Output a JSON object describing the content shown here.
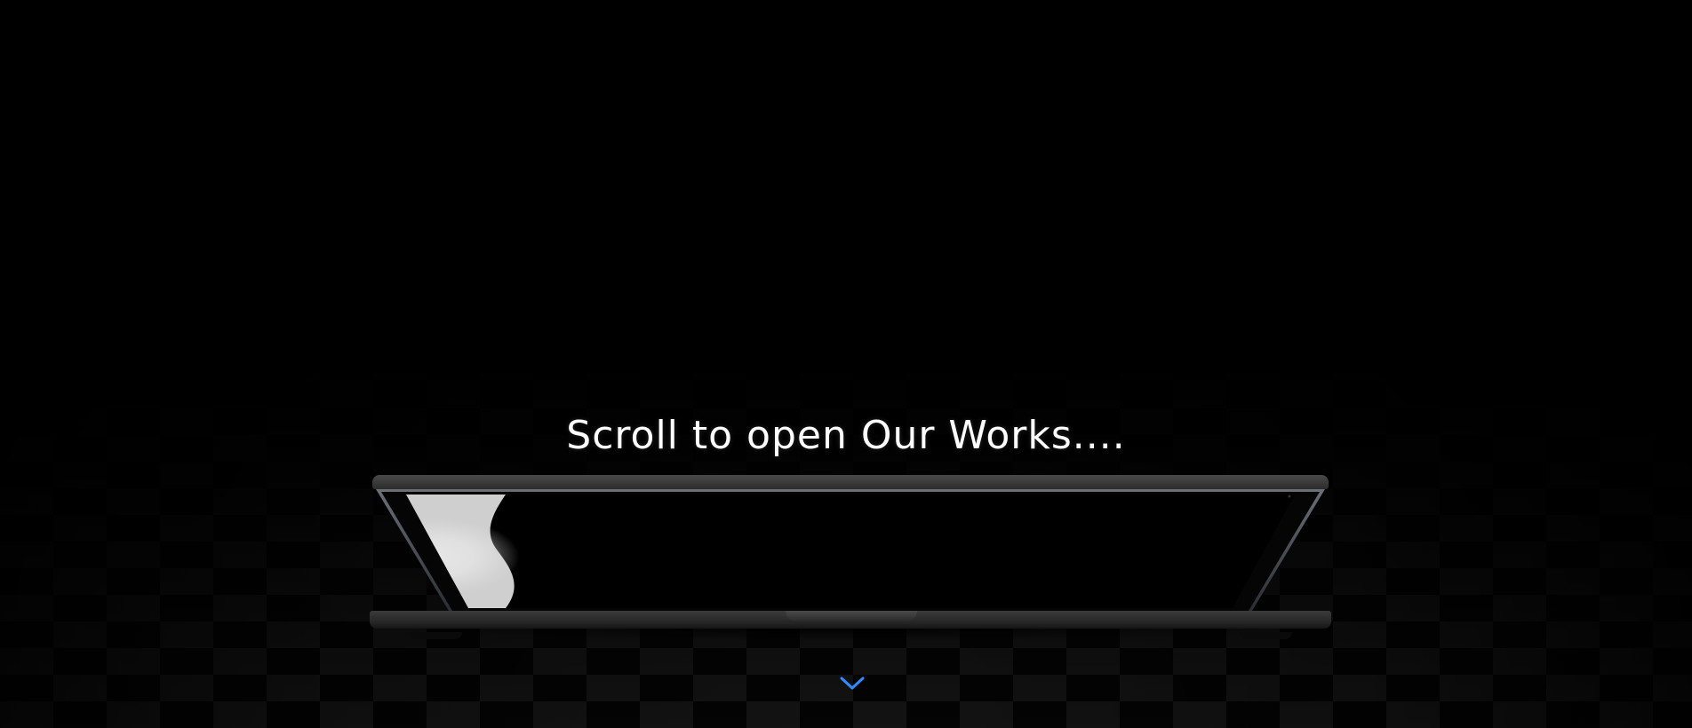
{
  "hero": {
    "headline": "Scroll to open Our Works...."
  },
  "scroll_hint": {
    "icon": "chevron-down-icon",
    "color": "#2f8cff"
  },
  "colors": {
    "background": "#000000",
    "text": "#ffffff",
    "accent": "#2f8cff"
  }
}
